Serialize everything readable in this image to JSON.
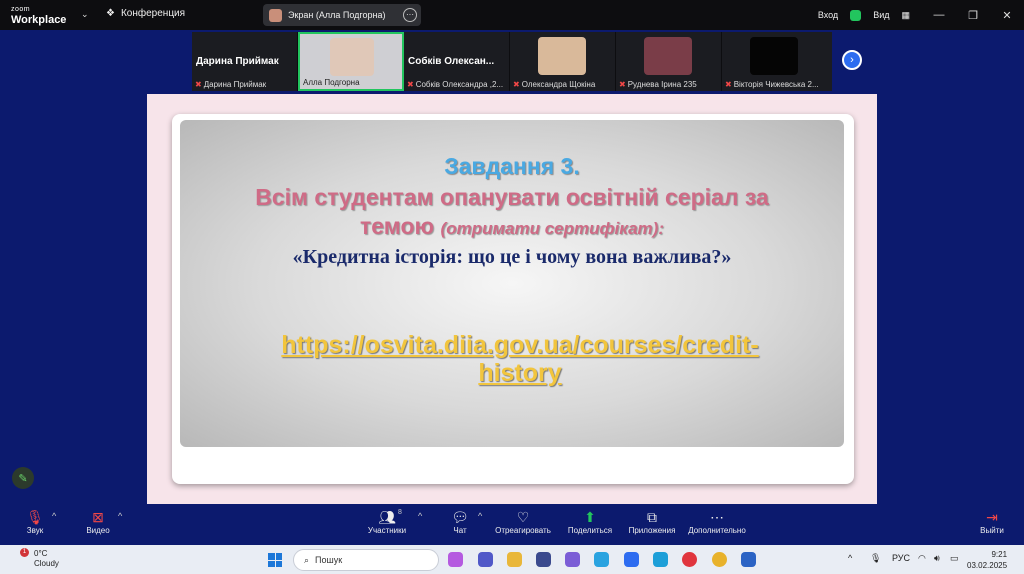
{
  "app": {
    "logo_top": "zoom",
    "logo_bottom": "Workplace",
    "conference_label": "Конференция",
    "screen_share_label": "Экран (Алла Подгорна)",
    "login_label": "Вход",
    "view_label": "Вид"
  },
  "participants": [
    {
      "display": "Дарина Приймак",
      "caption": "Дарина Приймак",
      "muted": true
    },
    {
      "display": "",
      "caption": "Алла Подгорна",
      "muted": false,
      "active": true
    },
    {
      "display": "Собків Олексан...",
      "caption": "Собків Олександра ,2...",
      "muted": true
    },
    {
      "display": "",
      "caption": "Олександра Щокіна",
      "muted": true
    },
    {
      "display": "",
      "caption": "Руднева Ірина 235",
      "muted": true
    },
    {
      "display": "",
      "caption": "Вікторія Чижевська 2...",
      "muted": true
    }
  ],
  "slide": {
    "task": "Завдання 3.",
    "line1": "Всім студентам опанувати освітній серіал за",
    "line2_main": "темою",
    "line2_italic": "(отримати сертифікат):",
    "quote": "«Кредитна історія: що це і чому вона важлива?»",
    "link_line1": "https://osvita.diia.gov.ua/courses/credit-",
    "link_line2": "history"
  },
  "toolbar": {
    "audio": "Звук",
    "video": "Видео",
    "participants": "Участники",
    "participants_count": "8",
    "chat": "Чат",
    "react": "Отреагировать",
    "share": "Поделиться",
    "apps": "Приложения",
    "more": "Дополнительно",
    "leave": "Выйти"
  },
  "taskbar": {
    "temp": "0°C",
    "weather": "Cloudy",
    "weather_badge": "1",
    "search": "Пошук",
    "lang": "РУС",
    "time": "9:21",
    "date": "03.02.2025"
  },
  "colors": {
    "zoom_bg": "#0c1a6e",
    "slide_task": "#4aa9e2",
    "slide_pink": "#cf6b86",
    "slide_link": "#f2c53d",
    "share_green": "#22c55e"
  }
}
